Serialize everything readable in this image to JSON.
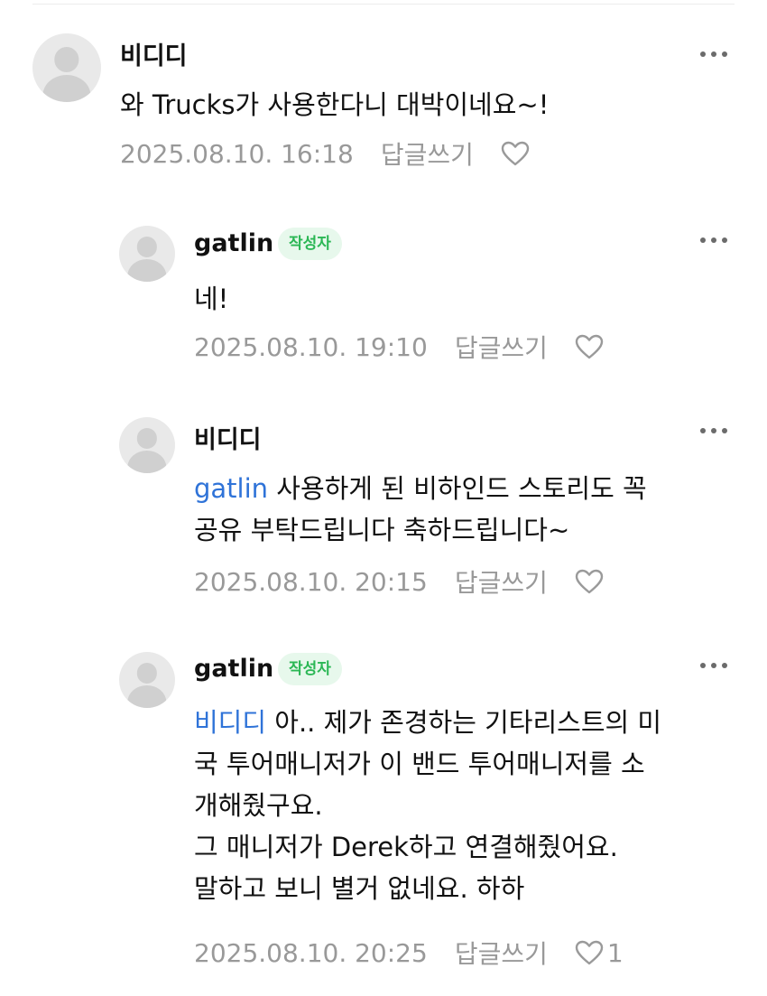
{
  "comments": [
    {
      "author": "비디디",
      "badge": null,
      "mention": "",
      "lines": [
        "와 Trucks가 사용한다니 대박이네요~!"
      ],
      "date": "2025.08.10. 16:18",
      "reply_label": "답글쓰기",
      "likes": ""
    },
    {
      "author": "gatlin",
      "badge": "작성자",
      "mention": "",
      "lines": [
        "네!"
      ],
      "date": "2025.08.10. 19:10",
      "reply_label": "답글쓰기",
      "likes": ""
    },
    {
      "author": "비디디",
      "badge": null,
      "mention": "gatlin",
      "lines": [
        " 사용하게 된 비하인드 스토리도 꼭",
        "공유 부탁드립니다 축하드립니다~"
      ],
      "date": "2025.08.10. 20:15",
      "reply_label": "답글쓰기",
      "likes": ""
    },
    {
      "author": "gatlin",
      "badge": "작성자",
      "mention": "비디디",
      "lines": [
        " 아.. 제가 존경하는 기타리스트의 미",
        "국 투어매니저가 이 밴드 투어매니저를 소",
        "개해줬구요.",
        "그 매니저가 Derek하고 연결해줬어요.",
        "말하고 보니 별거 없네요. 하하"
      ],
      "date": "2025.08.10. 20:25",
      "reply_label": "답글쓰기",
      "likes": "1"
    }
  ],
  "icons": {
    "avatar": "default-user-icon",
    "more": "more-horizontal-icon",
    "like": "heart-outline-icon"
  },
  "colors": {
    "mention": "#2f73d8",
    "badge_text": "#2bb755",
    "badge_bg": "#e7f8ec",
    "meta": "#999999"
  }
}
